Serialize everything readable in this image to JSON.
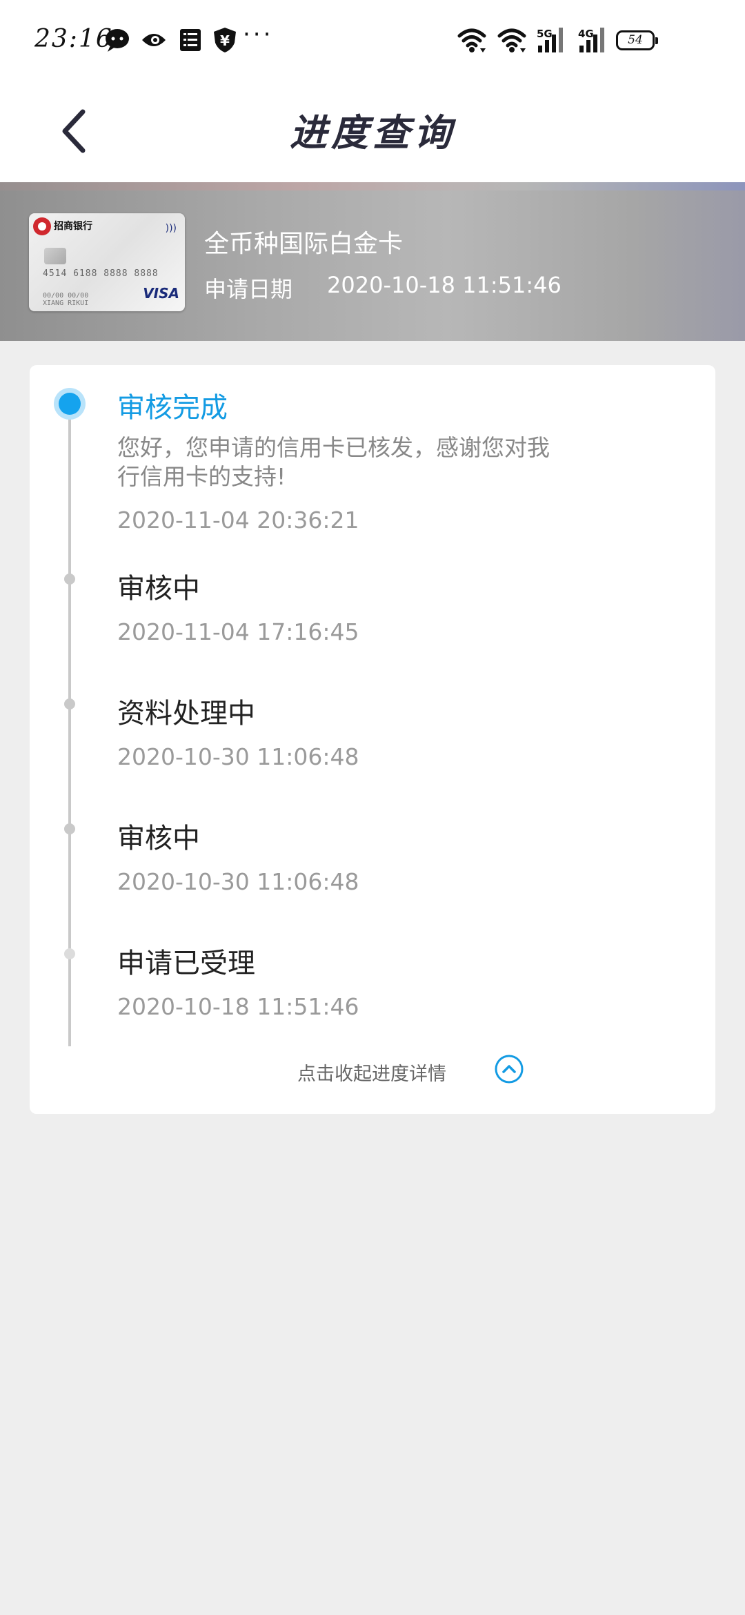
{
  "status_bar": {
    "time": "23:16",
    "icons": [
      "chat-bubble-icon",
      "eye-badge-icon",
      "list-doc-icon",
      "yuan-shield-icon",
      "more-dots-icon"
    ],
    "more": "···",
    "network": [
      "wifi-icon",
      "wifi-icon",
      "5G-signal-icon",
      "4G-signal-icon"
    ],
    "net_5g": "5G",
    "net_4g": "4G",
    "battery": "54"
  },
  "nav": {
    "title": "进度查询",
    "back_icon": "chevron-left-icon"
  },
  "card": {
    "bank_name": "招商银行",
    "number": "4514 6188 8888 8888",
    "valid": "00/00  00/00",
    "holder": "XIANG RIKUI",
    "brand": "VISA",
    "name": "全币种国际白金卡",
    "apply_date_label": "申请日期",
    "apply_date": "2020-10-18 11:51:46"
  },
  "timeline": [
    {
      "status": "审核完成",
      "message": "您好，您申请的信用卡已核发，感谢您对我行信用卡的支持!",
      "time": "2020-11-04 20:36:21",
      "active": true
    },
    {
      "status": "审核中",
      "time": "2020-11-04 17:16:45",
      "active": false
    },
    {
      "status": "资料处理中",
      "time": "2020-10-30 11:06:48",
      "active": false
    },
    {
      "status": "审核中",
      "time": "2020-10-30 11:06:48",
      "active": false
    },
    {
      "status": "申请已受理",
      "time": "2020-10-18 11:51:46",
      "active": false
    }
  ],
  "collapse": {
    "label": "点击收起进度详情",
    "icon": "chevron-up-circle-icon"
  },
  "colors": {
    "accent": "#139be3",
    "page_bg": "#eeeeee"
  }
}
